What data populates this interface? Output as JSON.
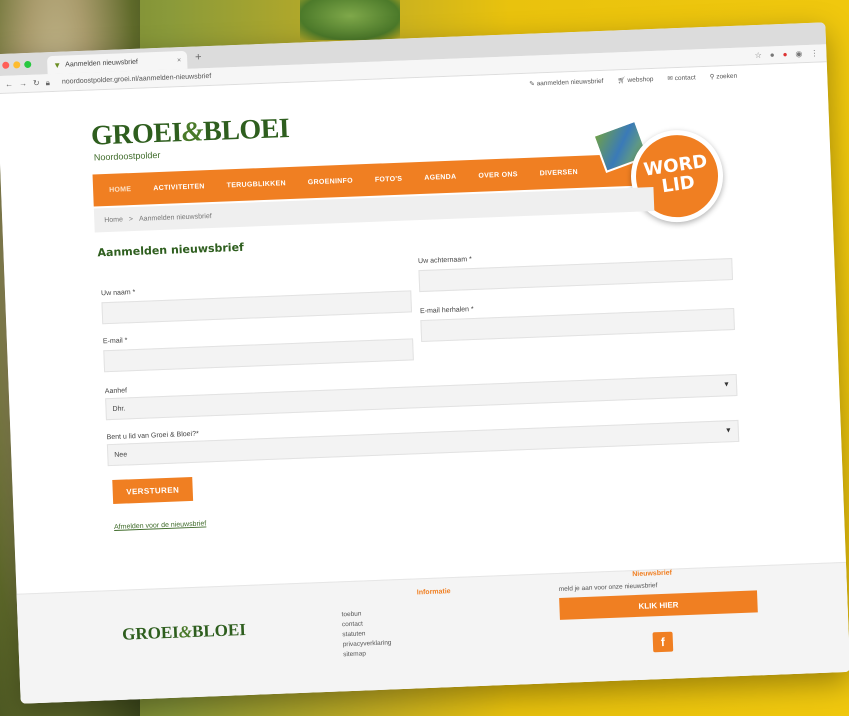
{
  "browser": {
    "tab_title": "Aanmelden nieuwsbrief",
    "new_tab": "+",
    "url": "noordoostpolder.groei.nl/aanmelden-nieuwsbrief"
  },
  "toplinks": {
    "newsletter": "aanmelden nieuwsbrief",
    "shop": "webshop",
    "contact": "contact",
    "search": "zoeken"
  },
  "logo": {
    "left": "GROEI",
    "amp": "&",
    "right": "BLOEI",
    "sub": "Noordoostpolder"
  },
  "nav": {
    "items": [
      "HOME",
      "ACTIVITEITEN",
      "TERUGBLIKKEN",
      "GROENINFO",
      "FOTO'S",
      "AGENDA",
      "OVER ONS",
      "DIVERSEN"
    ]
  },
  "badge": {
    "line1": "WORD",
    "line2": "LID"
  },
  "breadcrumb": {
    "home": "Home",
    "sep": ">",
    "current": "Aanmelden nieuwsbrief"
  },
  "form": {
    "title": "Aanmelden nieuwsbrief",
    "first_name_label": "Uw naam *",
    "last_name_label": "Uw achternaam *",
    "email_label": "E-mail *",
    "email_repeat_label": "E-mail herhalen *",
    "title_label": "Aanhef",
    "title_value": "Dhr.",
    "member_label": "Bent u lid van Groei & Bloei?*",
    "member_value": "Nee",
    "submit": "VERSTUREN",
    "unsubscribe": "Afmelden voor de nieuwsbrief"
  },
  "footer": {
    "info_title": "Informatie",
    "links": [
      "toebun",
      "contact",
      "statuten",
      "privacyverklaring",
      "sitemap"
    ],
    "newsletter_title": "Nieuwsbrief",
    "newsletter_text": "meld je aan voor onze nieuwsbrief",
    "newsletter_button": "KLIK HIER",
    "facebook": "f"
  },
  "colors": {
    "accent": "#f07f22",
    "brand_green": "#2e5e1e"
  }
}
